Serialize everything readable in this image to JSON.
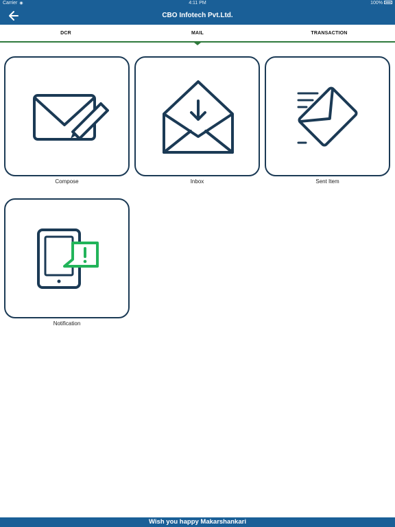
{
  "status_bar": {
    "carrier": "Carrier",
    "time": "4:11 PM",
    "battery": "100%"
  },
  "nav": {
    "title": "CBO Infotech Pvt.Ltd."
  },
  "tabs": [
    {
      "label": "DCR"
    },
    {
      "label": "MAIL",
      "selected": true
    },
    {
      "label": "TRANSACTION"
    }
  ],
  "tiles": [
    {
      "label": "Compose",
      "icon": "compose-mail-icon"
    },
    {
      "label": "Inbox",
      "icon": "inbox-envelope-icon"
    },
    {
      "label": "Sent Item",
      "icon": "sent-envelope-icon"
    },
    {
      "label": "Notification",
      "icon": "tablet-alert-icon"
    }
  ],
  "footer": {
    "message": "Wish you happy Makarshankari"
  },
  "colors": {
    "primary": "#1a5f97",
    "accent_green": "#2f7a3c",
    "icon_navy": "#1b3a55",
    "alert_green": "#22b45a"
  }
}
